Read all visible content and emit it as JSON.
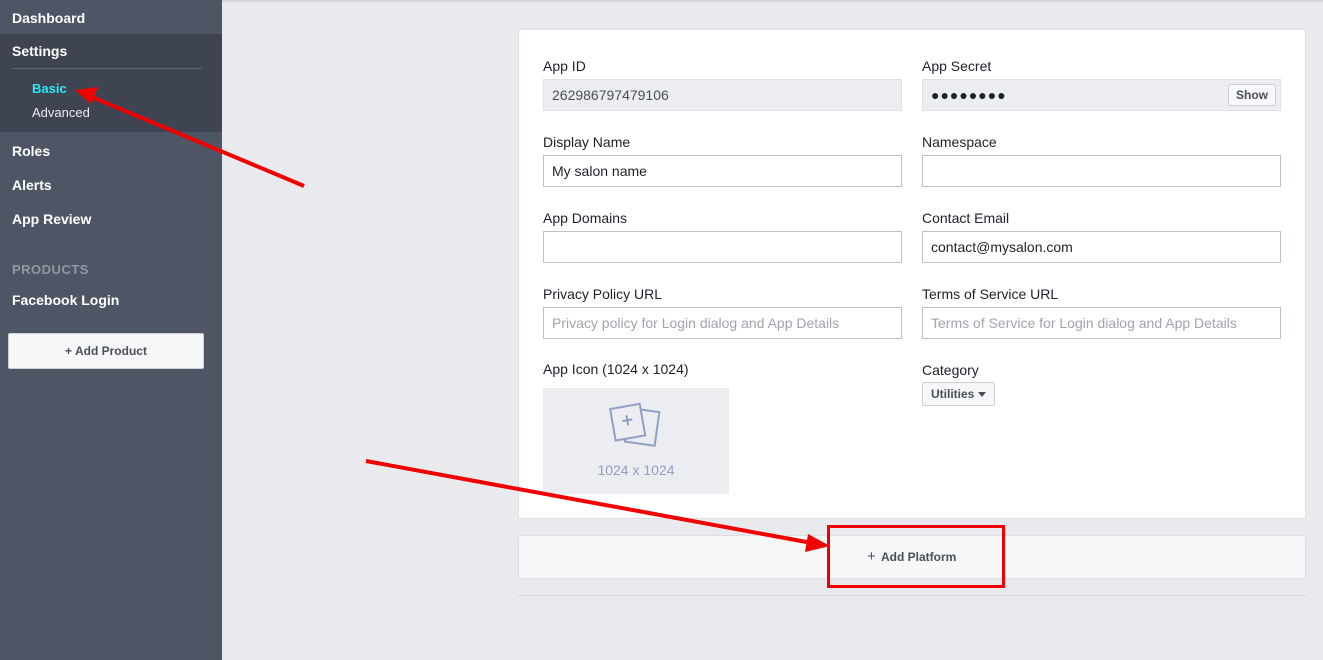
{
  "sidebar": {
    "dashboard": "Dashboard",
    "settings": "Settings",
    "basic": "Basic",
    "advanced": "Advanced",
    "roles": "Roles",
    "alerts": "Alerts",
    "app_review": "App Review",
    "products_header": "PRODUCTS",
    "facebook_login": "Facebook Login",
    "add_product": "+ Add Product"
  },
  "form": {
    "app_id_label": "App ID",
    "app_id_value": "262986797479106",
    "app_secret_label": "App Secret",
    "app_secret_value": "●●●●●●●●",
    "show_button": "Show",
    "display_name_label": "Display Name",
    "display_name_value": "My salon name",
    "namespace_label": "Namespace",
    "namespace_value": "",
    "app_domains_label": "App Domains",
    "app_domains_value": "",
    "contact_email_label": "Contact Email",
    "contact_email_value": "contact@mysalon.com",
    "privacy_label": "Privacy Policy URL",
    "privacy_placeholder": "Privacy policy for Login dialog and App Details",
    "tos_label": "Terms of Service URL",
    "tos_placeholder": "Terms of Service for Login dialog and App Details",
    "app_icon_label": "App Icon (1024 x 1024)",
    "app_icon_size": "1024 x 1024",
    "category_label": "Category",
    "category_value": "Utilities"
  },
  "add_platform": {
    "plus": "+",
    "label": "Add Platform"
  },
  "colors": {
    "sidebar_bg": "#4e5665",
    "active_link": "#2ee7f7",
    "annotation_red": "#f20000"
  }
}
